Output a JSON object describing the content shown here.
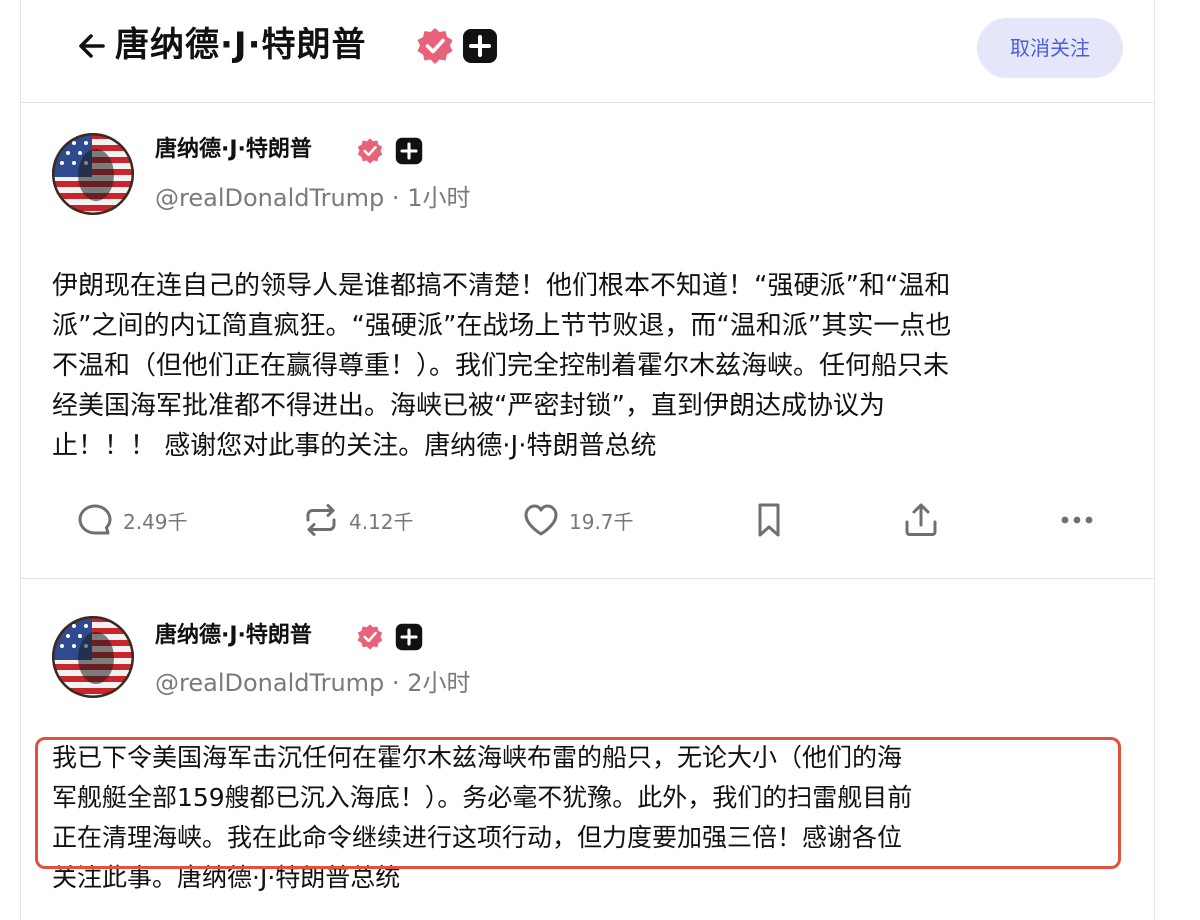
{
  "header": {
    "title": "唐纳德·J·特朗普",
    "unfollow_label": "取消关注"
  },
  "colors": {
    "verified": "#e8627a",
    "accent_button_bg": "#e6e6fb",
    "accent_button_text": "#4b5fd6",
    "highlight_border": "#e0523a",
    "muted_text": "#7a7a7a"
  },
  "posts": [
    {
      "author": "唐纳德·J·特朗普",
      "handle": "@realDonaldTrump",
      "separator": " · ",
      "time": "1小时",
      "text": "伊朗现在连自己的领导人是谁都搞不清楚！他们根本不知道！“强硬派”和“温和\n派”之间的内讧简直疯狂。“强硬派”在战场上节节败退，而“温和派”其实一点也\n不温和（但他们正在赢得尊重！）。我们完全控制着霍尔木兹海峡。任何船只未\n经美国海军批准都不得进出。海峡已被“严密封锁”，直到伊朗达成协议为\n止！！！ 感谢您对此事的关注。唐纳德·J·特朗普总统",
      "actions": {
        "replies": "2.49千",
        "reposts": "4.12千",
        "likes": "19.7千"
      }
    },
    {
      "author": "唐纳德·J·特朗普",
      "handle": "@realDonaldTrump",
      "separator": " · ",
      "time": "2小时",
      "text": "我已下令美国海军击沉任何在霍尔木兹海峡布雷的船只，无论大小（他们的海\n军舰艇全部159艘都已沉入海底！）。务必毫不犹豫。此外，我们的扫雷舰目前\n正在清理海峡。我在此命令继续进行这项行动，但力度要加强三倍！感谢各位\n关注此事。唐纳德·J·特朗普总统"
    }
  ],
  "icons": {
    "back": "arrow-left-icon",
    "verified": "verified-badge-icon",
    "plus": "plus-badge-icon",
    "reply": "reply-icon",
    "repost": "repost-icon",
    "like": "heart-icon",
    "bookmark": "bookmark-icon",
    "share": "share-icon",
    "more": "more-icon"
  }
}
